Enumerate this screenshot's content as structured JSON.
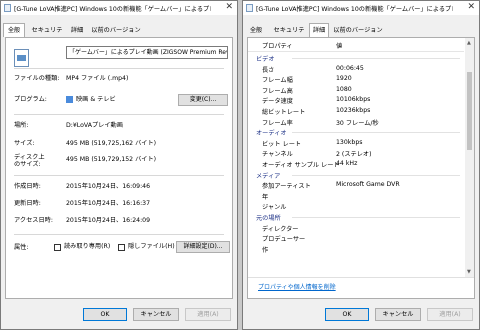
{
  "general": {
    "title": "[G-Tune LoVA推進PC] Windows 10の新機能「ゲームバー」によるプレイ...",
    "tabs": [
      "全般",
      "セキュリティ",
      "詳細",
      "以前のバージョン"
    ],
    "file_name": "「ゲームバー」によるプレイ動画 (ZIGSOW Premium Review)",
    "file_type_label": "ファイルの種類:",
    "file_type": "MP4 ファイル (.mp4)",
    "program_label": "プログラム:",
    "program": "映画 & テレビ",
    "change_button": "変更(C)...",
    "location_label": "場所:",
    "location": "D:¥LoVAプレイ動画",
    "size_label": "サイズ:",
    "size": "495 MB (519,725,162 バイト)",
    "disk_size_label_1": "ディスク上",
    "disk_size_label_2": "のサイズ:",
    "disk_size": "495 MB (519,729,152 バイト)",
    "created_label": "作成日時:",
    "created": "2015年10月24日、16:09:46",
    "modified_label": "更新日時:",
    "modified": "2015年10月24日、16:16:37",
    "accessed_label": "アクセス日時:",
    "accessed": "2015年10月24日、16:24:09",
    "attributes_label": "属性:",
    "readonly_label": "読み取り専用(R)",
    "hidden_label": "隠しファイル(H)",
    "advanced_button": "詳細設定(D)...",
    "ok": "OK",
    "cancel": "キャンセル",
    "apply": "適用(A)"
  },
  "details": {
    "title": "[G-Tune LoVA推進PC] Windows 10の新機能「ゲームバー」によるプレイ...",
    "tabs": [
      "全般",
      "セキュリティ",
      "詳細",
      "以前のバージョン"
    ],
    "col_property": "プロパティ",
    "col_value": "値",
    "rows": [
      {
        "k": "ビデオ",
        "v": "",
        "group": true
      },
      {
        "k": "長さ",
        "v": "00:06:45"
      },
      {
        "k": "フレーム幅",
        "v": "1920"
      },
      {
        "k": "フレーム高",
        "v": "1080"
      },
      {
        "k": "データ速度",
        "v": "10106kbps"
      },
      {
        "k": "総ビットレート",
        "v": "10236kbps"
      },
      {
        "k": "フレーム率",
        "v": "30 フレーム/秒"
      },
      {
        "k": "オーディオ",
        "v": "",
        "group": true
      },
      {
        "k": "ビット レート",
        "v": "130kbps"
      },
      {
        "k": "チャンネル",
        "v": "2 (ステレオ)"
      },
      {
        "k": "オーディオ サンプル レート",
        "v": "44 kHz"
      },
      {
        "k": "メディア",
        "v": "",
        "group": true
      },
      {
        "k": "参加アーティスト",
        "v": "Microsoft Game DVR"
      },
      {
        "k": "年",
        "v": ""
      },
      {
        "k": "ジャンル",
        "v": ""
      },
      {
        "k": "元の場所",
        "v": "",
        "group": true
      },
      {
        "k": "ディレクター",
        "v": ""
      },
      {
        "k": "プロデューサー",
        "v": ""
      },
      {
        "k": "作",
        "v": ""
      }
    ],
    "remove_link": "プロパティや個人情報を削除",
    "ok": "OK",
    "cancel": "キャンセル",
    "apply": "適用(A)"
  }
}
